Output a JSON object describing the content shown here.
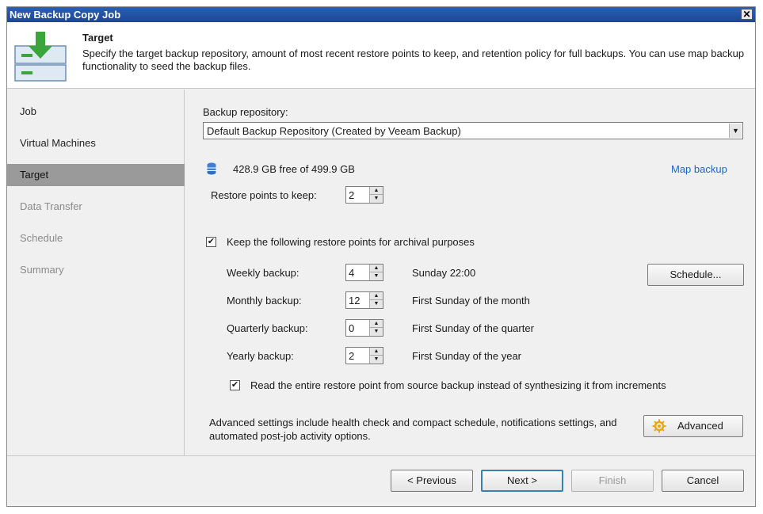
{
  "window": {
    "title": "New Backup Copy Job",
    "close_glyph": "✕"
  },
  "header": {
    "title": "Target",
    "description": "Specify the target backup repository, amount of most recent restore points to keep, and retention policy for full backups. You can use map backup functionality to seed the backup files.",
    "icon": "backup-target-icon"
  },
  "sidebar": {
    "items": [
      {
        "label": "Job",
        "state": "normal"
      },
      {
        "label": "Virtual Machines",
        "state": "normal"
      },
      {
        "label": "Target",
        "state": "active"
      },
      {
        "label": "Data Transfer",
        "state": "disabled"
      },
      {
        "label": "Schedule",
        "state": "disabled"
      },
      {
        "label": "Summary",
        "state": "disabled"
      }
    ]
  },
  "repository": {
    "label": "Backup repository:",
    "selected": "Default Backup Repository (Created by Veeam Backup)",
    "free_space": "428.9 GB free of 499.9 GB",
    "map_backup_link": "Map backup"
  },
  "restore_points": {
    "label": "Restore points to keep:",
    "value": "2"
  },
  "archival": {
    "checkbox_label": "Keep the following restore points for archival purposes",
    "checked": true,
    "rows": [
      {
        "label": "Weekly backup:",
        "value": "4",
        "schedule": "Sunday 22:00"
      },
      {
        "label": "Monthly backup:",
        "value": "12",
        "schedule": "First Sunday of the month"
      },
      {
        "label": "Quarterly backup:",
        "value": "0",
        "schedule": "First Sunday of the quarter"
      },
      {
        "label": "Yearly backup:",
        "value": "2",
        "schedule": "First Sunday of the year"
      }
    ],
    "schedule_button": "Schedule...",
    "read_entire_label": "Read the entire restore point from source backup instead of synthesizing it from increments",
    "read_entire_checked": true
  },
  "advanced": {
    "text": "Advanced settings include health check and compact schedule, notifications settings, and automated post-job activity options.",
    "button_label": "Advanced"
  },
  "footer": {
    "previous": "< Previous",
    "next": "Next >",
    "finish": "Finish",
    "cancel": "Cancel"
  },
  "colors": {
    "title_bar": "#1e4fa0",
    "link": "#1f63c9",
    "active_nav": "#9a9a9a",
    "accent_green": "#3aa53a"
  }
}
